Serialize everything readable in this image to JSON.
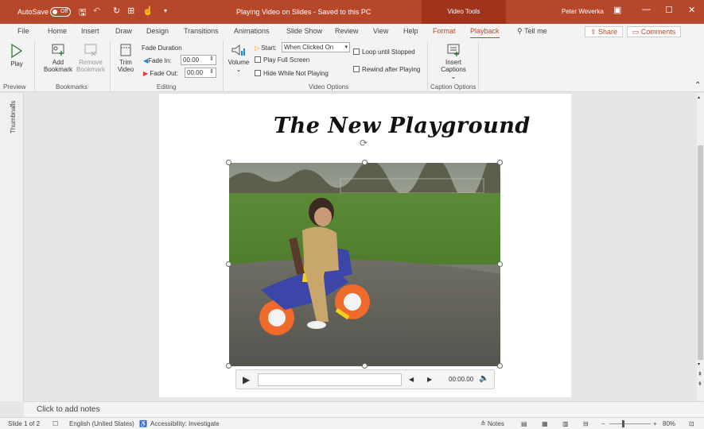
{
  "titlebar": {
    "autosave_label": "AutoSave",
    "autosave_state": "Off",
    "doc_title": "Playing Video on Slides  -  Saved to this PC",
    "context_tab_group": "Video Tools",
    "user_name": "Peter Weverka",
    "accent_color": "#b7472a"
  },
  "tabs": [
    "File",
    "Home",
    "Insert",
    "Draw",
    "Design",
    "Transitions",
    "Animations",
    "Slide Show",
    "Review",
    "View",
    "Help",
    "Format",
    "Playback"
  ],
  "active_tab": "Playback",
  "tell_me": "Tell me",
  "share_label": "Share",
  "comments_label": "Comments",
  "ribbon": {
    "play": "Play",
    "add_bookmark_1": "Add",
    "add_bookmark_2": "Bookmark",
    "remove_bookmark_1": "Remove",
    "remove_bookmark_2": "Bookmark",
    "trim_1": "Trim",
    "trim_2": "Video",
    "fade_duration": "Fade Duration",
    "fade_in_label": "Fade In:",
    "fade_in_value": "00.00",
    "fade_out_label": "Fade Out:",
    "fade_out_value": "00.00",
    "volume": "Volume",
    "start_label": "Start:",
    "start_value": "When Clicked On",
    "play_full_screen": "Play Full Screen",
    "hide_while_not_playing": "Hide While Not Playing",
    "loop_until_stopped": "Loop until Stopped",
    "rewind_after_playing": "Rewind after Playing",
    "insert_captions_1": "Insert",
    "insert_captions_2": "Captions",
    "groups": {
      "preview": "Preview",
      "bookmarks": "Bookmarks",
      "editing": "Editing",
      "video_options": "Video Options",
      "caption_options": "Caption Options"
    }
  },
  "thumbnails_label": "Thumbnails",
  "slide": {
    "title": "The New Playground"
  },
  "player": {
    "time": "00:00.00",
    "progress": 0
  },
  "notes_placeholder": "Click to add notes",
  "status": {
    "slide_info": "Slide 1 of 2",
    "language": "English (United States)",
    "accessibility": "Accessibility: Investigate",
    "notes_button": "Notes",
    "zoom": "80%"
  }
}
